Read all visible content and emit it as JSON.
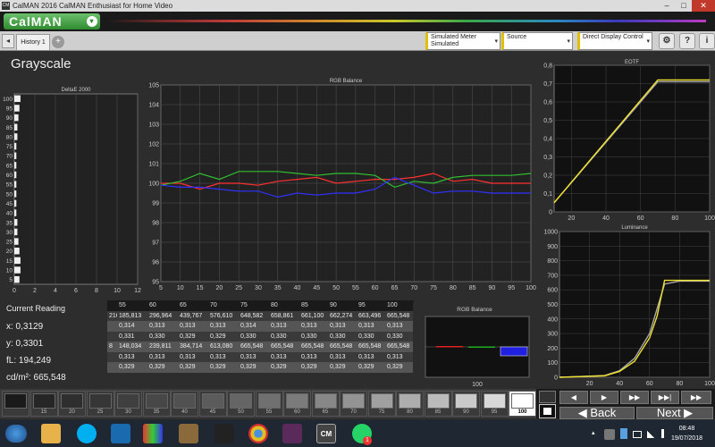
{
  "window": {
    "title": "CalMAN 2016 CalMAN Enthusiast for Home Video",
    "app_icon": "CM",
    "minimize": "–",
    "maximize": "□",
    "close": "✕"
  },
  "logo": {
    "text": "CalMAN",
    "dropdown_icon": "▾"
  },
  "toolbar": {
    "back_arrow": "◂",
    "tab_label": "History 1",
    "add_tab": "+",
    "meter": {
      "line1": "Simulated Meter",
      "line2": "Simulated"
    },
    "source": {
      "line1": "Source"
    },
    "display": {
      "line1": "Direct Display Control"
    },
    "settings_icon": "⚙",
    "help_icon": "?",
    "info_icon": "i",
    "dropdown_arrow": "▾"
  },
  "page": {
    "title": "Grayscale"
  },
  "deltae": {
    "title": "DeltaE 2000",
    "y_ticks": [
      "100",
      "95",
      "90",
      "85",
      "80",
      "75",
      "70",
      "65",
      "60",
      "55",
      "50",
      "45",
      "40",
      "35",
      "30",
      "25",
      "20",
      "15",
      "10",
      "5"
    ],
    "x_ticks": [
      "0",
      "2",
      "4",
      "6",
      "8",
      "10",
      "12"
    ],
    "bar_values": [
      0.6,
      0.5,
      0.4,
      0.3,
      0.3,
      0.2,
      0.2,
      0.2,
      0.2,
      0.2,
      0.2,
      0.2,
      0.2,
      0.3,
      0.3,
      0.4,
      0.5,
      0.6,
      0.6,
      0.5
    ]
  },
  "rgb_balance": {
    "title": "RGB Balance",
    "y_ticks": [
      "105",
      "104",
      "103",
      "102",
      "101",
      "100",
      "99",
      "98",
      "97",
      "96",
      "95"
    ],
    "x_ticks": [
      "5",
      "10",
      "15",
      "20",
      "25",
      "30",
      "35",
      "40",
      "45",
      "50",
      "55",
      "60",
      "65",
      "70",
      "75",
      "80",
      "85",
      "90",
      "95",
      "100"
    ]
  },
  "eotf": {
    "title": "EOTF",
    "y_ticks": [
      "0,8",
      "0,7",
      "0,6",
      "0,5",
      "0,4",
      "0,3",
      "0,2",
      "0,1",
      "0"
    ],
    "x_ticks": [
      "20",
      "40",
      "60",
      "80",
      "100"
    ]
  },
  "luminance": {
    "title": "Luminance",
    "y_ticks": [
      "1000",
      "900",
      "800",
      "700",
      "600",
      "500",
      "400",
      "300",
      "200",
      "100",
      "0"
    ],
    "x_ticks": [
      "20",
      "40",
      "60",
      "80",
      "100"
    ]
  },
  "rgb_bar": {
    "title": "RGB Balance",
    "x_label": "100"
  },
  "reading": {
    "title": "Current Reading",
    "x": "x: 0,3129",
    "y": "y: 0,3301",
    "fl": "fL: 194,249",
    "cdm": "cd/m²: 665,548"
  },
  "table": {
    "headers": [
      "",
      "55",
      "60",
      "65",
      "70",
      "75",
      "80",
      "85",
      "90",
      "95",
      "100"
    ],
    "rows": [
      [
        "216",
        "185,813",
        "296,964",
        "439,767",
        "576,610",
        "648,582",
        "658,861",
        "661,100",
        "662,274",
        "663,496",
        "665,548"
      ],
      [
        "",
        "0,314",
        "0,313",
        "0,313",
        "0,313",
        "0,314",
        "0,313",
        "0,313",
        "0,313",
        "0,313",
        "0,313"
      ],
      [
        "",
        "0,331",
        "0,330",
        "0,329",
        "0,329",
        "0,330",
        "0,330",
        "0,330",
        "0,330",
        "0,330",
        "0,330"
      ],
      [
        "8",
        "148,034",
        "239,811",
        "384,714",
        "613,080",
        "665,548",
        "665,548",
        "665,548",
        "665,548",
        "665,548",
        "665,548"
      ],
      [
        "",
        "0,313",
        "0,313",
        "0,313",
        "0,313",
        "0,313",
        "0,313",
        "0,313",
        "0,313",
        "0,313",
        "0,313"
      ],
      [
        "",
        "0,329",
        "0,329",
        "0,329",
        "0,329",
        "0,329",
        "0,329",
        "0,329",
        "0,329",
        "0,329",
        "0,329"
      ]
    ]
  },
  "swatches": [
    {
      "label": "",
      "gray": "#1a1a1a"
    },
    {
      "label": "15",
      "gray": "#262626"
    },
    {
      "label": "20",
      "gray": "#2e2e2e"
    },
    {
      "label": "25",
      "gray": "#363636"
    },
    {
      "label": "30",
      "gray": "#3f3f3f"
    },
    {
      "label": "35",
      "gray": "#474747"
    },
    {
      "label": "40",
      "gray": "#515151"
    },
    {
      "label": "45",
      "gray": "#5b5b5b"
    },
    {
      "label": "50",
      "gray": "#656565"
    },
    {
      "label": "55",
      "gray": "#707070"
    },
    {
      "label": "60",
      "gray": "#7b7b7b"
    },
    {
      "label": "65",
      "gray": "#878787"
    },
    {
      "label": "70",
      "gray": "#939393"
    },
    {
      "label": "75",
      "gray": "#a0a0a0"
    },
    {
      "label": "80",
      "gray": "#adadad"
    },
    {
      "label": "85",
      "gray": "#bbbbbb"
    },
    {
      "label": "90",
      "gray": "#c9c9c9"
    },
    {
      "label": "95",
      "gray": "#d8d8d8"
    },
    {
      "label": "100",
      "gray": "#ffffff"
    }
  ],
  "nav": {
    "back": "Back",
    "next": "Next",
    "prev_icon": "◀",
    "play_icon": "▶",
    "next_icon": "▶▶",
    "fwd_icon": "▶▶|"
  },
  "taskbar": {
    "cm_label": "CM",
    "badge": "1",
    "time": "08:48",
    "date": "19/07/2018",
    "chevron": "▴"
  },
  "chart_data": [
    {
      "type": "bar",
      "title": "DeltaE 2000",
      "categories": [
        "5",
        "10",
        "15",
        "20",
        "25",
        "30",
        "35",
        "40",
        "45",
        "50",
        "55",
        "60",
        "65",
        "70",
        "75",
        "80",
        "85",
        "90",
        "95",
        "100"
      ],
      "values": [
        0.5,
        0.6,
        0.6,
        0.5,
        0.4,
        0.3,
        0.3,
        0.2,
        0.2,
        0.2,
        0.2,
        0.2,
        0.2,
        0.2,
        0.2,
        0.2,
        0.3,
        0.3,
        0.4,
        0.5
      ],
      "xlim": [
        0,
        12
      ]
    },
    {
      "type": "line",
      "title": "RGB Balance",
      "x": [
        5,
        10,
        15,
        20,
        25,
        30,
        35,
        40,
        45,
        50,
        55,
        60,
        65,
        70,
        75,
        80,
        85,
        90,
        95,
        100
      ],
      "series": [
        {
          "color": "#ff3030",
          "values": [
            100.0,
            100.0,
            99.7,
            100.0,
            100.0,
            99.9,
            100.1,
            100.2,
            100.3,
            100.0,
            100.1,
            100.2,
            100.2,
            100.3,
            100.5,
            100.1,
            100.2,
            100.0,
            100.0,
            100.0
          ]
        },
        {
          "color": "#30c030",
          "values": [
            99.9,
            100.1,
            100.5,
            100.2,
            100.6,
            100.6,
            100.6,
            100.5,
            100.4,
            100.5,
            100.5,
            100.4,
            99.8,
            100.1,
            100.0,
            100.3,
            100.4,
            100.4,
            100.4,
            100.5
          ]
        },
        {
          "color": "#3030ff",
          "values": [
            99.9,
            99.8,
            99.8,
            99.7,
            99.6,
            99.6,
            99.3,
            99.5,
            99.4,
            99.5,
            99.5,
            99.7,
            100.3,
            99.9,
            99.5,
            99.6,
            99.6,
            99.5,
            99.5,
            99.5
          ]
        }
      ],
      "ylim": [
        95,
        105
      ]
    },
    {
      "type": "line",
      "title": "EOTF",
      "x": [
        10,
        70,
        100
      ],
      "series": [
        {
          "color": "#f0e030",
          "values": [
            0.05,
            0.72,
            0.72
          ]
        },
        {
          "color": "#aaaaaa",
          "values": [
            0.05,
            0.71,
            0.71
          ]
        }
      ],
      "xlim": [
        10,
        100
      ],
      "ylim": [
        0,
        0.8
      ]
    },
    {
      "type": "line",
      "title": "Luminance",
      "x": [
        0,
        30,
        40,
        50,
        60,
        65,
        70,
        80,
        100
      ],
      "series": [
        {
          "color": "#f0e030",
          "values": [
            0,
            10,
            40,
            110,
            270,
            420,
            665,
            665,
            665
          ]
        },
        {
          "color": "#aaaaaa",
          "values": [
            0,
            12,
            45,
            130,
            300,
            470,
            640,
            660,
            660
          ]
        }
      ],
      "xlim": [
        0,
        100
      ],
      "ylim": [
        0,
        1000
      ]
    },
    {
      "type": "bar",
      "title": "RGB Balance",
      "categories": [
        "R",
        "G",
        "B"
      ],
      "values": [
        0.1,
        0.05,
        -1.0
      ]
    }
  ]
}
